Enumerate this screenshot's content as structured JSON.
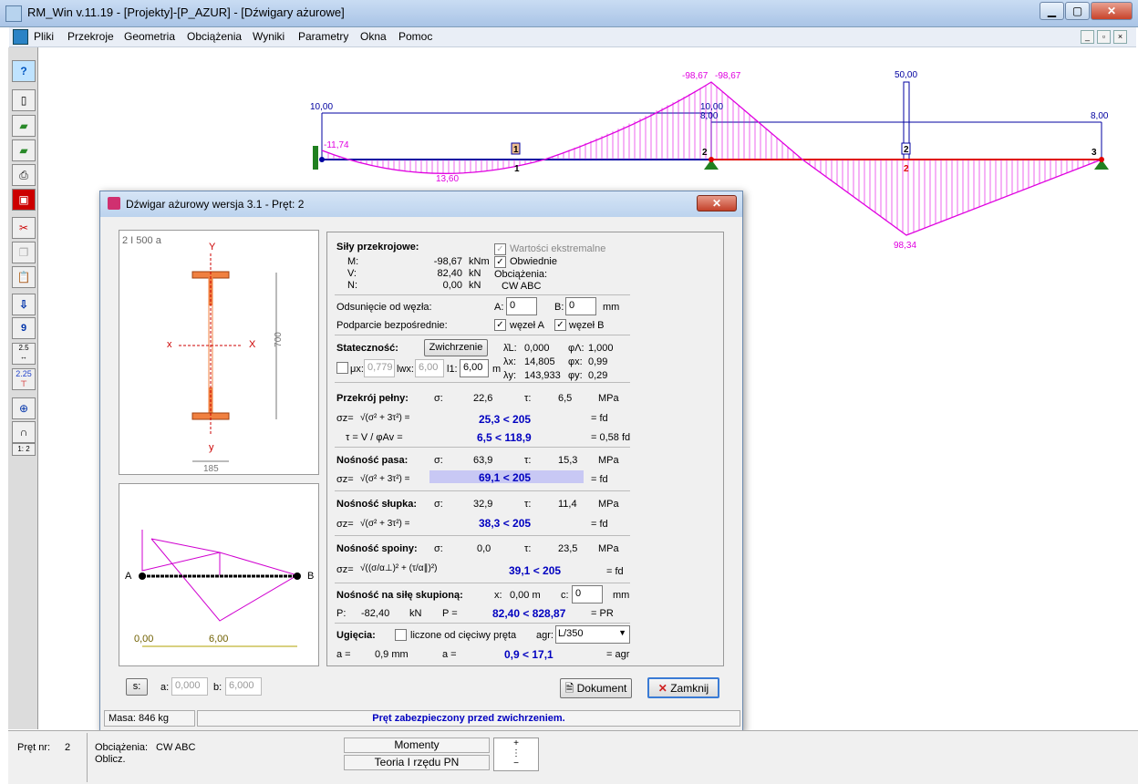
{
  "window": {
    "title": "RM_Win v.11.19 - [Projekty]-[P_AZUR] - [Dźwigary ażurowe]",
    "btn_min": "▁",
    "btn_max": "▢",
    "btn_close": "✕"
  },
  "menu": [
    "Pliki",
    "Przekroje",
    "Geometria",
    "Obciążenia",
    "Wyniki",
    "Parametry",
    "Okna",
    "Pomoc"
  ],
  "toolbar": {
    "help": "?",
    "load": "9",
    "dim1": "2.5",
    "dim2": "2.25",
    "scale": "1: 2"
  },
  "diagram": {
    "val_10": "10,00",
    "val_neg1174": "-11,74",
    "val_1360": "13,60",
    "val_peak_a": "-98,67",
    "val_peak_b": "-98,67",
    "val_1000b": "10,00",
    "val_800a": "8,00",
    "val_50": "50,00",
    "val_800b": "8,00",
    "val_9834": "98,34",
    "n1": "1",
    "n1box": "1",
    "n2": "2",
    "n2box": "2",
    "n2b": "2",
    "n3": "3",
    "colors": {
      "moment": "#e000e0",
      "bar_left": "#0000a0",
      "bar_right": "#e00000",
      "support": "#208020"
    }
  },
  "dialog": {
    "title": "Dźwigar ażurowy wersja 3.1 - Pręt: 2",
    "close": "✕",
    "section_name": "2 I 500 a",
    "axis_y_top": "Y",
    "axis_y_bot": "y",
    "axis_x_left": "x",
    "axis_x_right": "X",
    "dim_h": "700",
    "dim_w": "185",
    "beam_A": "A",
    "beam_B": "B",
    "beam_000": "0,00",
    "beam_600": "6,00",
    "forces": {
      "title": "Siły przekrojowe:",
      "M_lbl": "M:",
      "M_val": "-98,67",
      "M_unit": "kNm",
      "V_lbl": "V:",
      "V_val": "82,40",
      "V_unit": "kN",
      "N_lbl": "N:",
      "N_val": "0,00",
      "N_unit": "kN",
      "ext": "Wartości ekstremalne",
      "env": "Obwiednie",
      "loads_lbl": "Obciążenia:",
      "loads_val": "CW ABC",
      "chk": "✓"
    },
    "offset": {
      "label": "Odsunięcie od węzła:",
      "A_lbl": "A:",
      "A_val": "0",
      "B_lbl": "B:",
      "B_val": "0",
      "unit": "mm"
    },
    "support": {
      "label": "Podparcie bezpośrednie:",
      "a": "węzeł A",
      "b": "węzeł B"
    },
    "stab": {
      "title": "Stateczność:",
      "btn": "Zwichrzenie",
      "l_lbl": "λ̄L:",
      "l_val": "0,000",
      "fl_lbl": "φΛ:",
      "fl_val": "1,000",
      "lx_lbl": "λx:",
      "lx_val": "14,805",
      "fx_lbl": "φx:",
      "fx_val": "0,99",
      "ly_lbl": "λy:",
      "ly_val": "143,933",
      "fy_lbl": "φy:",
      "fy_val": "0,29",
      "mu_lbl": "μx:",
      "mu_val": "0,779",
      "lwx_lbl": "lwx:",
      "lwx_val": "6,00",
      "l1_lbl": "l1:",
      "l1_val": "6,00",
      "l1_unit": "m"
    },
    "full": {
      "title": "Przekrój pełny:",
      "s_lbl": "σ:",
      "s_val": "22,6",
      "t_lbl": "τ:",
      "t_val": "6,5",
      "unit": "MPa",
      "sz": "σz=",
      "eq": "√(σ² + 3τ²) =",
      "r1": "25,3 < 205",
      "fd1": "= fd",
      "tau_eq": "τ = V / φAv =",
      "r2": "6,5 < 118,9",
      "fd2": "= 0,58 fd"
    },
    "pas": {
      "title": "Nośność pasa:",
      "s_val": "63,9",
      "t_val": "15,3",
      "r": "69,1 < 205"
    },
    "slup": {
      "title": "Nośność słupka:",
      "s_val": "32,9",
      "t_val": "11,4",
      "r": "38,3 < 205"
    },
    "spoina": {
      "title": "Nośność spoiny:",
      "s_val": "0,0",
      "t_val": "23,5",
      "eq": "√((σ/α⊥)² + (τ/α∥)²)",
      "r": "39,1 < 205"
    },
    "skup": {
      "title": "Nośność na siłę skupioną:",
      "x_lbl": "x:",
      "x_val": "0,00 m",
      "c_lbl": "c:",
      "c_val": "0",
      "c_unit": "mm",
      "P_lbl": "P:",
      "P_val": "-82,40",
      "P_unit": "kN",
      "P_eq": "P =",
      "r": "82,40 < 828,87",
      "pr": "= PR"
    },
    "ugiecia": {
      "title": "Ugięcia:",
      "chk_lbl": "liczone od cięciwy pręta",
      "agr_lbl": "agr:",
      "agr_val": "L/350",
      "a_lbl": "a =",
      "a_val": "0,9 mm",
      "a_eq": "a =",
      "r": "0,9 < 17,1",
      "agr_eq": "= agr"
    },
    "bottom": {
      "s_btn": "s:",
      "a_lbl": "a:",
      "a_val": "0,000",
      "b_lbl": "b:",
      "b_val": "6,000",
      "doc_btn": "Dokument",
      "close_btn": "Zamknij"
    },
    "status": {
      "mass": "Masa: 846 kg",
      "msg": "Pręt zabezpieczony przed zwichrzeniem."
    }
  },
  "statusbar": {
    "pret_lbl": "Pręt nr:",
    "pret_val": "2",
    "obc_lbl": "Obciążenia:",
    "obc_val": "CW ABC",
    "oblicz": "Oblicz.",
    "mode": "Momenty",
    "theory": "Teoria I rzędu PN"
  }
}
